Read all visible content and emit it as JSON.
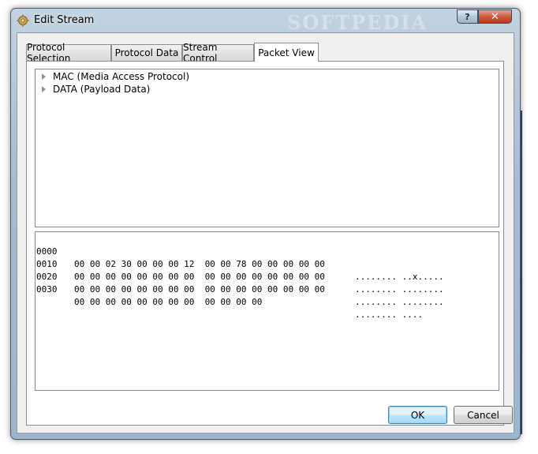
{
  "window": {
    "title": "Edit Stream",
    "watermark": "SOFTPEDIA",
    "help_label": "?",
    "close_label": "✕"
  },
  "tabs": [
    {
      "label": "Protocol Selection"
    },
    {
      "label": "Protocol Data"
    },
    {
      "label": "Stream Control"
    },
    {
      "label": "Packet View"
    }
  ],
  "active_tab": "Packet View",
  "tree": {
    "items": [
      {
        "label": "MAC (Media Access Protocol)"
      },
      {
        "label": "DATA (Payload Data)"
      }
    ]
  },
  "hex": {
    "rows": [
      {
        "offset": "0000",
        "bytes": "00 00 02 30 00 00 00 12  00 00 78 00 00 00 00 00",
        "ascii": "........ ..x....."
      },
      {
        "offset": "0010",
        "bytes": "00 00 00 00 00 00 00 00  00 00 00 00 00 00 00 00",
        "ascii": "........ ........"
      },
      {
        "offset": "0020",
        "bytes": "00 00 00 00 00 00 00 00  00 00 00 00 00 00 00 00",
        "ascii": "........ ........"
      },
      {
        "offset": "0030",
        "bytes": "00 00 00 00 00 00 00 00  00 00 00 00",
        "ascii": "........ ...."
      }
    ]
  },
  "buttons": {
    "ok": "OK",
    "cancel": "Cancel"
  },
  "colors": {
    "default_button_border": "#3c7fb1",
    "close_button": "#c9452a"
  }
}
